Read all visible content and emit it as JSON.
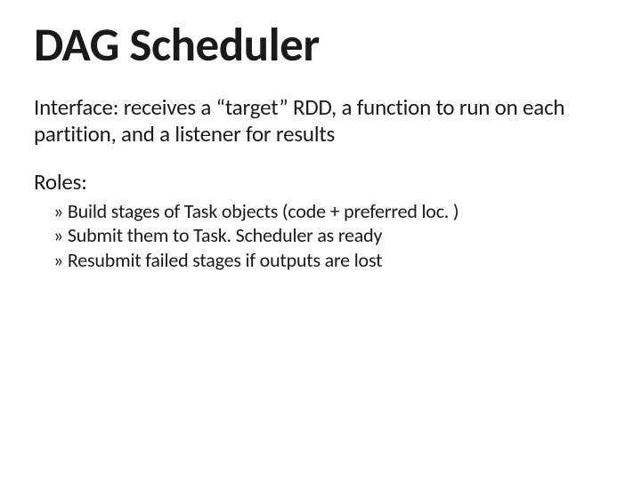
{
  "title": "DAG Scheduler",
  "interface_paragraph": "Interface: receives a “target” RDD, a function to run on each partition, and a listener for results",
  "roles_label": "Roles:",
  "roles": [
    "Build stages of Task objects (code + preferred loc. )",
    "Submit them to Task. Scheduler as ready",
    "Resubmit failed stages if outputs are lost"
  ]
}
